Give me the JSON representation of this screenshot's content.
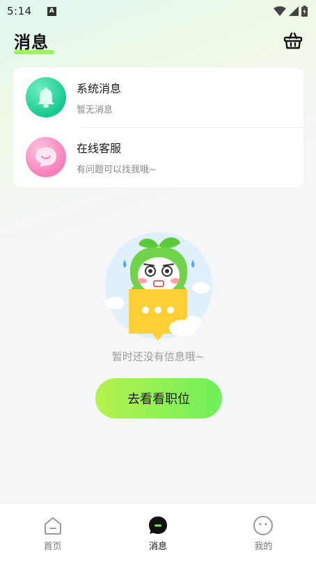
{
  "status_bar": {
    "time": "5:14",
    "notification_icon": "A"
  },
  "header": {
    "title": "消息",
    "basket_icon": "basket-icon"
  },
  "messages": [
    {
      "title": "系统消息",
      "subtitle": "暂无消息",
      "icon": "bell-icon",
      "color": "#1cc98f"
    },
    {
      "title": "在线客服",
      "subtitle": "有问题可以找我哦~",
      "icon": "chat-bubble-icon",
      "color": "#f77fb8"
    }
  ],
  "empty_state": {
    "text": "暂时还没有信息哦~",
    "button_label": "去看看职位"
  },
  "nav": {
    "items": [
      {
        "label": "首页",
        "icon": "home-icon",
        "active": false
      },
      {
        "label": "消息",
        "icon": "message-icon",
        "active": true
      },
      {
        "label": "我的",
        "icon": "profile-icon",
        "active": false
      }
    ]
  },
  "colors": {
    "accent": "#8cf05a",
    "green_avatar": "#1cc98f",
    "pink_avatar": "#f77fb8"
  }
}
